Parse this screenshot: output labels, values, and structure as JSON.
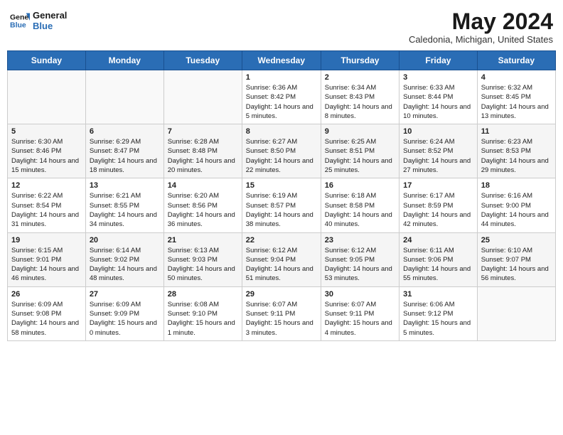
{
  "header": {
    "logo_line1": "General",
    "logo_line2": "Blue",
    "month_year": "May 2024",
    "location": "Caledonia, Michigan, United States"
  },
  "weekdays": [
    "Sunday",
    "Monday",
    "Tuesday",
    "Wednesday",
    "Thursday",
    "Friday",
    "Saturday"
  ],
  "weeks": [
    [
      {
        "day": "",
        "sunrise": "",
        "sunset": "",
        "daylight": ""
      },
      {
        "day": "",
        "sunrise": "",
        "sunset": "",
        "daylight": ""
      },
      {
        "day": "",
        "sunrise": "",
        "sunset": "",
        "daylight": ""
      },
      {
        "day": "1",
        "sunrise": "Sunrise: 6:36 AM",
        "sunset": "Sunset: 8:42 PM",
        "daylight": "Daylight: 14 hours and 5 minutes."
      },
      {
        "day": "2",
        "sunrise": "Sunrise: 6:34 AM",
        "sunset": "Sunset: 8:43 PM",
        "daylight": "Daylight: 14 hours and 8 minutes."
      },
      {
        "day": "3",
        "sunrise": "Sunrise: 6:33 AM",
        "sunset": "Sunset: 8:44 PM",
        "daylight": "Daylight: 14 hours and 10 minutes."
      },
      {
        "day": "4",
        "sunrise": "Sunrise: 6:32 AM",
        "sunset": "Sunset: 8:45 PM",
        "daylight": "Daylight: 14 hours and 13 minutes."
      }
    ],
    [
      {
        "day": "5",
        "sunrise": "Sunrise: 6:30 AM",
        "sunset": "Sunset: 8:46 PM",
        "daylight": "Daylight: 14 hours and 15 minutes."
      },
      {
        "day": "6",
        "sunrise": "Sunrise: 6:29 AM",
        "sunset": "Sunset: 8:47 PM",
        "daylight": "Daylight: 14 hours and 18 minutes."
      },
      {
        "day": "7",
        "sunrise": "Sunrise: 6:28 AM",
        "sunset": "Sunset: 8:48 PM",
        "daylight": "Daylight: 14 hours and 20 minutes."
      },
      {
        "day": "8",
        "sunrise": "Sunrise: 6:27 AM",
        "sunset": "Sunset: 8:50 PM",
        "daylight": "Daylight: 14 hours and 22 minutes."
      },
      {
        "day": "9",
        "sunrise": "Sunrise: 6:25 AM",
        "sunset": "Sunset: 8:51 PM",
        "daylight": "Daylight: 14 hours and 25 minutes."
      },
      {
        "day": "10",
        "sunrise": "Sunrise: 6:24 AM",
        "sunset": "Sunset: 8:52 PM",
        "daylight": "Daylight: 14 hours and 27 minutes."
      },
      {
        "day": "11",
        "sunrise": "Sunrise: 6:23 AM",
        "sunset": "Sunset: 8:53 PM",
        "daylight": "Daylight: 14 hours and 29 minutes."
      }
    ],
    [
      {
        "day": "12",
        "sunrise": "Sunrise: 6:22 AM",
        "sunset": "Sunset: 8:54 PM",
        "daylight": "Daylight: 14 hours and 31 minutes."
      },
      {
        "day": "13",
        "sunrise": "Sunrise: 6:21 AM",
        "sunset": "Sunset: 8:55 PM",
        "daylight": "Daylight: 14 hours and 34 minutes."
      },
      {
        "day": "14",
        "sunrise": "Sunrise: 6:20 AM",
        "sunset": "Sunset: 8:56 PM",
        "daylight": "Daylight: 14 hours and 36 minutes."
      },
      {
        "day": "15",
        "sunrise": "Sunrise: 6:19 AM",
        "sunset": "Sunset: 8:57 PM",
        "daylight": "Daylight: 14 hours and 38 minutes."
      },
      {
        "day": "16",
        "sunrise": "Sunrise: 6:18 AM",
        "sunset": "Sunset: 8:58 PM",
        "daylight": "Daylight: 14 hours and 40 minutes."
      },
      {
        "day": "17",
        "sunrise": "Sunrise: 6:17 AM",
        "sunset": "Sunset: 8:59 PM",
        "daylight": "Daylight: 14 hours and 42 minutes."
      },
      {
        "day": "18",
        "sunrise": "Sunrise: 6:16 AM",
        "sunset": "Sunset: 9:00 PM",
        "daylight": "Daylight: 14 hours and 44 minutes."
      }
    ],
    [
      {
        "day": "19",
        "sunrise": "Sunrise: 6:15 AM",
        "sunset": "Sunset: 9:01 PM",
        "daylight": "Daylight: 14 hours and 46 minutes."
      },
      {
        "day": "20",
        "sunrise": "Sunrise: 6:14 AM",
        "sunset": "Sunset: 9:02 PM",
        "daylight": "Daylight: 14 hours and 48 minutes."
      },
      {
        "day": "21",
        "sunrise": "Sunrise: 6:13 AM",
        "sunset": "Sunset: 9:03 PM",
        "daylight": "Daylight: 14 hours and 50 minutes."
      },
      {
        "day": "22",
        "sunrise": "Sunrise: 6:12 AM",
        "sunset": "Sunset: 9:04 PM",
        "daylight": "Daylight: 14 hours and 51 minutes."
      },
      {
        "day": "23",
        "sunrise": "Sunrise: 6:12 AM",
        "sunset": "Sunset: 9:05 PM",
        "daylight": "Daylight: 14 hours and 53 minutes."
      },
      {
        "day": "24",
        "sunrise": "Sunrise: 6:11 AM",
        "sunset": "Sunset: 9:06 PM",
        "daylight": "Daylight: 14 hours and 55 minutes."
      },
      {
        "day": "25",
        "sunrise": "Sunrise: 6:10 AM",
        "sunset": "Sunset: 9:07 PM",
        "daylight": "Daylight: 14 hours and 56 minutes."
      }
    ],
    [
      {
        "day": "26",
        "sunrise": "Sunrise: 6:09 AM",
        "sunset": "Sunset: 9:08 PM",
        "daylight": "Daylight: 14 hours and 58 minutes."
      },
      {
        "day": "27",
        "sunrise": "Sunrise: 6:09 AM",
        "sunset": "Sunset: 9:09 PM",
        "daylight": "Daylight: 15 hours and 0 minutes."
      },
      {
        "day": "28",
        "sunrise": "Sunrise: 6:08 AM",
        "sunset": "Sunset: 9:10 PM",
        "daylight": "Daylight: 15 hours and 1 minute."
      },
      {
        "day": "29",
        "sunrise": "Sunrise: 6:07 AM",
        "sunset": "Sunset: 9:11 PM",
        "daylight": "Daylight: 15 hours and 3 minutes."
      },
      {
        "day": "30",
        "sunrise": "Sunrise: 6:07 AM",
        "sunset": "Sunset: 9:11 PM",
        "daylight": "Daylight: 15 hours and 4 minutes."
      },
      {
        "day": "31",
        "sunrise": "Sunrise: 6:06 AM",
        "sunset": "Sunset: 9:12 PM",
        "daylight": "Daylight: 15 hours and 5 minutes."
      },
      {
        "day": "",
        "sunrise": "",
        "sunset": "",
        "daylight": ""
      }
    ]
  ]
}
